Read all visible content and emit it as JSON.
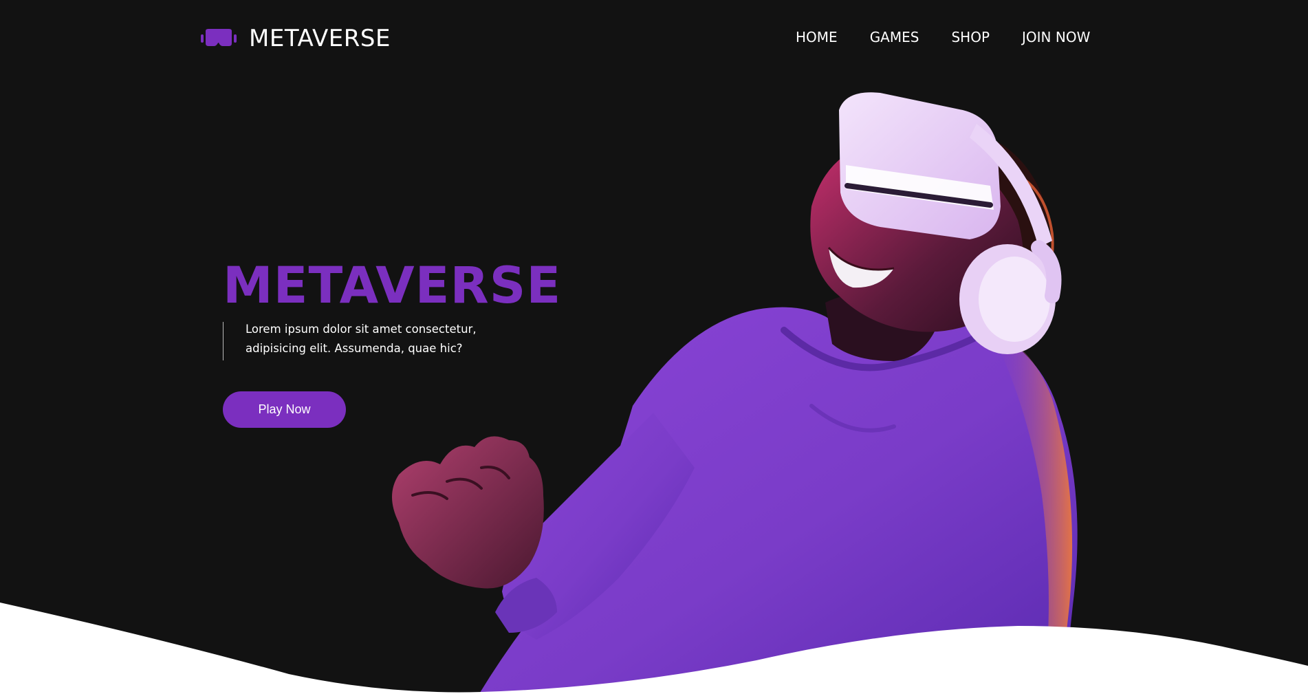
{
  "brand": {
    "name": "METAVERSE",
    "icon": "vr-headset-icon",
    "accent": "#7b2fbf"
  },
  "nav": {
    "items": [
      "HOME",
      "GAMES",
      "SHOP",
      "JOIN NOW"
    ]
  },
  "hero": {
    "title": "METAVERSE",
    "description": [
      "Lorem ipsum dolor sit amet consectetur,",
      "adipisicing elit. Assumenda, quae hic?"
    ],
    "cta": "Play Now",
    "image": "person-wearing-vr-headset-image"
  },
  "colors": {
    "background": "#121212",
    "wave": "#ffffff",
    "text": "#ffffff"
  }
}
